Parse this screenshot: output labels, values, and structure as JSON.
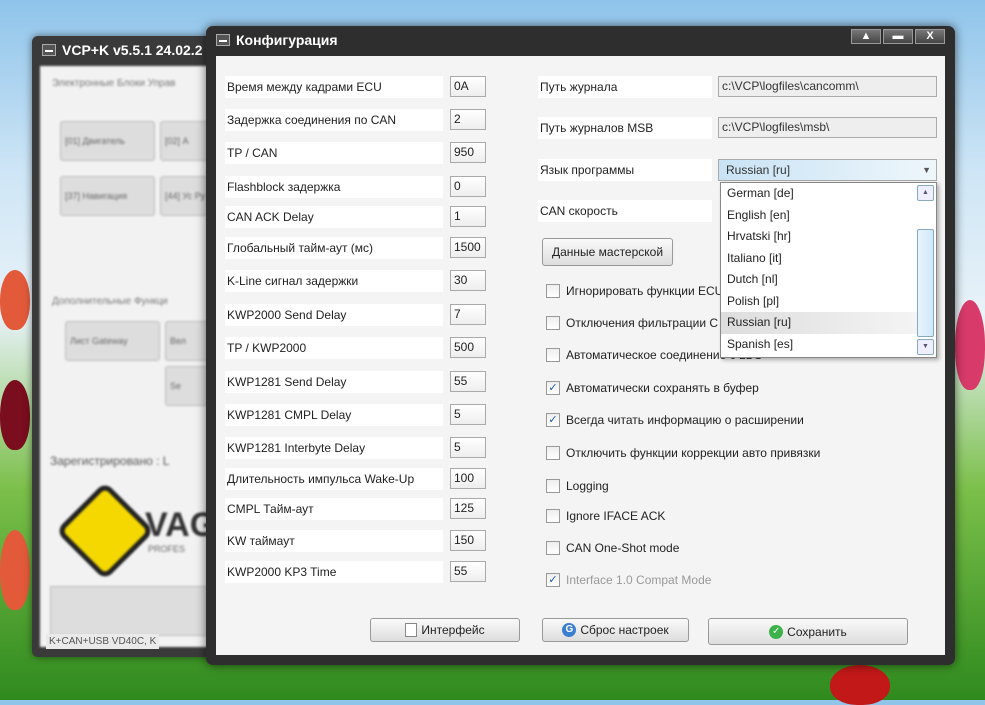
{
  "background_window": {
    "title": "VCP+K v5.5.1 24.02.2",
    "group1": "Электронные Блоки Управ",
    "buttons": [
      "[01] Двигатель",
      "[02] А",
      "[37] Навигация",
      "[44] Ус Ру"
    ],
    "group2": "Дополнительные Функци",
    "extra_buttons": [
      "Лист Gateway",
      "Вел",
      "Se"
    ],
    "registered": "Зарегистрировано : L",
    "logo_text": "VAG",
    "logo_sub": "PROFES",
    "status": "K+CAN+USB VD40C, K"
  },
  "dialog": {
    "title": "Конфигурация",
    "controls": [
      "▲",
      "▬",
      "X"
    ]
  },
  "left_settings": [
    {
      "label": "Время между кадрами ECU",
      "value": "0A"
    },
    {
      "label": "Задержка соединения по CAN",
      "value": "2"
    },
    {
      "label": "TP / CAN",
      "value": "950"
    },
    {
      "label": "Flashblock задержка",
      "value": "0"
    },
    {
      "label": "CAN ACK Delay",
      "value": "1"
    },
    {
      "label": "Глобальный тайм-аут (мс)",
      "value": "1500"
    },
    {
      "label": "K-Line сигнал задержки",
      "value": "30"
    },
    {
      "label": "KWP2000 Send Delay",
      "value": "7"
    },
    {
      "label": "TP / KWP2000",
      "value": "500"
    },
    {
      "label": "KWP1281 Send Delay",
      "value": "55"
    },
    {
      "label": "KWP1281 CMPL Delay",
      "value": "5"
    },
    {
      "label": "KWP1281 Interbyte Delay",
      "value": "5"
    },
    {
      "label": "Длительность импульса Wake-Up",
      "value": "100"
    },
    {
      "label": "CMPL Тайм-аут",
      "value": "125"
    },
    {
      "label": "KW таймаут",
      "value": "150"
    },
    {
      "label": "KWP2000 KP3 Time",
      "value": "55"
    }
  ],
  "right_settings": {
    "log_path_label": "Путь журнала",
    "log_path": "c:\\VCP\\logfiles\\cancomm\\",
    "msb_path_label": "Путь журналов MSB",
    "msb_path": "c:\\VCP\\logfiles\\msb\\",
    "language_label": "Язык программы",
    "language_selected": "Russian [ru]",
    "can_speed_label": "CAN скорость",
    "workshop_button": "Данные мастерской",
    "language_options": [
      "German [de]",
      "English [en]",
      "Hrvatski [hr]",
      "Italiano [it]",
      "Dutch [nl]",
      "Polish [pl]",
      "Russian [ru]",
      "Spanish [es]"
    ]
  },
  "checkboxes": [
    {
      "label": "Игнорировать функции ECU",
      "checked": false
    },
    {
      "label": "Отключения фильтрации C",
      "checked": false
    },
    {
      "label": "Автоматическое соединение с LDS",
      "checked": false
    },
    {
      "label": "Автоматически сохранять в буфер",
      "checked": true
    },
    {
      "label": "Всегда читать информацию о расширении",
      "checked": true
    },
    {
      "label": "Отключить функции коррекции авто привязки",
      "checked": false
    },
    {
      "label": "Logging",
      "checked": false
    },
    {
      "label": "Ignore IFACE ACK",
      "checked": false
    },
    {
      "label": "CAN One-Shot mode",
      "checked": false
    },
    {
      "label": "Interface 1.0 Compat Mode",
      "checked": true,
      "disabled": true
    }
  ],
  "footer": {
    "interface": "Интерфейс",
    "reset": "Сброс настроек",
    "save": "Сохранить"
  }
}
